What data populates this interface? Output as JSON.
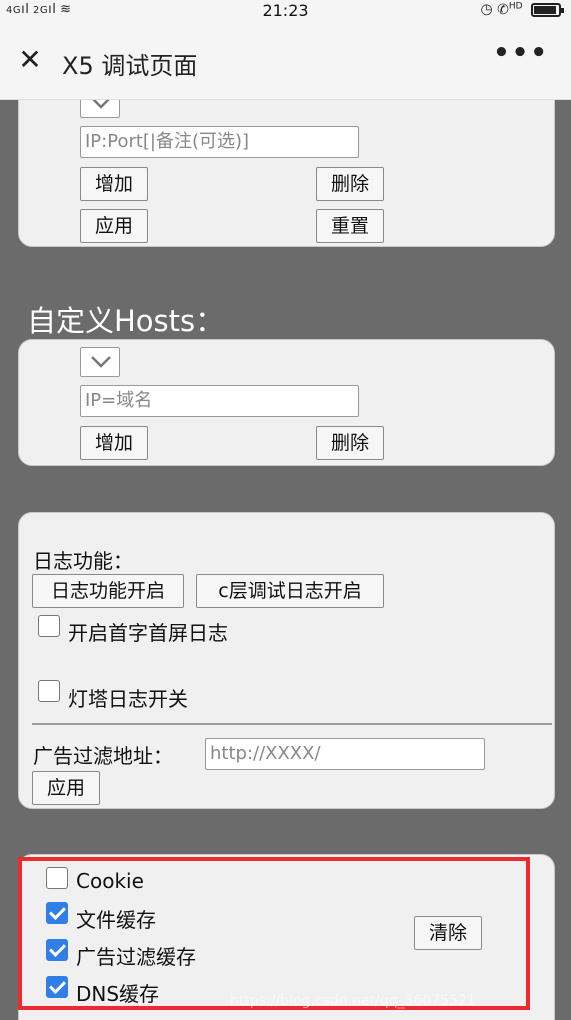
{
  "status_bar": {
    "network_left": "4G",
    "network_right": "2G",
    "time": "21:23",
    "hd_label": "HD",
    "icons": [
      "signal-icon",
      "wifi-icon",
      "alarm-icon",
      "call-hd-icon",
      "battery-icon"
    ]
  },
  "titlebar": {
    "title": "X5 调试页面",
    "close_glyph": "✕",
    "more_glyph": "•••"
  },
  "proxy_card": {
    "input_placeholder": "IP:Port[|备注(可选)]",
    "add_label": "增加",
    "delete_label": "删除",
    "apply_label": "应用",
    "reset_label": "重置"
  },
  "hosts": {
    "section_title": "自定义Hosts：",
    "input_placeholder": "IP=域名",
    "add_label": "增加",
    "delete_label": "删除"
  },
  "log": {
    "heading": "日志功能：",
    "log_on_label": "日志功能开启",
    "c_layer_log_label": "c层调试日志开启",
    "first_screen_label": "开启首字首屏日志",
    "first_screen_checked": false,
    "beacon_label": "灯塔日志开关",
    "beacon_checked": false,
    "adfilter_label": "广告过滤地址：",
    "adfilter_placeholder": "http://XXXX/",
    "apply_label": "应用"
  },
  "cache": {
    "items": [
      {
        "label": "Cookie",
        "checked": false
      },
      {
        "label": "文件缓存",
        "checked": true
      },
      {
        "label": "广告过滤缓存",
        "checked": true
      },
      {
        "label": "DNS缓存",
        "checked": true
      }
    ],
    "clear_label": "清除"
  },
  "watermark": "https://blog.csdn.net/qq_36075521",
  "colors": {
    "background": "#6b6b6b",
    "card": "#f0f0f0",
    "accent_checkbox": "#2f7fe6",
    "highlight": "#ee2b2b"
  }
}
